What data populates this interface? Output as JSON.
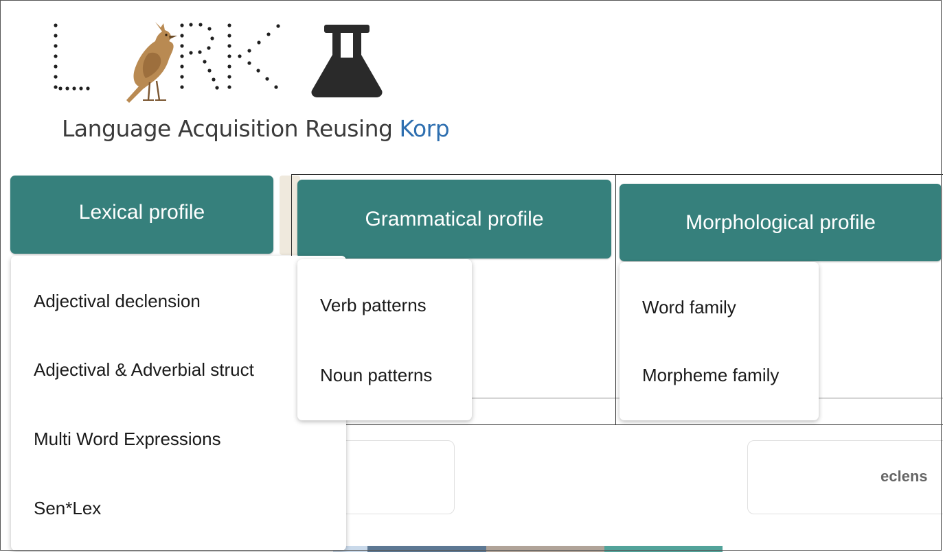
{
  "header": {
    "logo_name": "LARK",
    "logo_icon": "lark-bird-icon",
    "lab_icon": "flask-icon",
    "tagline_prefix": "Language Acquisition Reusing ",
    "tagline_highlight": "Korp",
    "highlight_color": "#2e6fb0"
  },
  "profiles": {
    "lexical": {
      "label": "Lexical profile",
      "items": [
        "Adjectival declension",
        "Adjectival & Adverbial struct",
        "Multi Word Expressions",
        "Sen*Lex"
      ]
    },
    "grammatical": {
      "label": "Grammatical profile",
      "items": [
        "Verb patterns",
        "Noun patterns"
      ]
    },
    "morphological": {
      "label": "Morphological profile",
      "items": [
        "Word family",
        "Morpheme family"
      ]
    }
  },
  "background": {
    "partial_card_text": "eclens"
  },
  "colors": {
    "accent": "#36807c",
    "tagline_text": "#3b3b3b"
  }
}
